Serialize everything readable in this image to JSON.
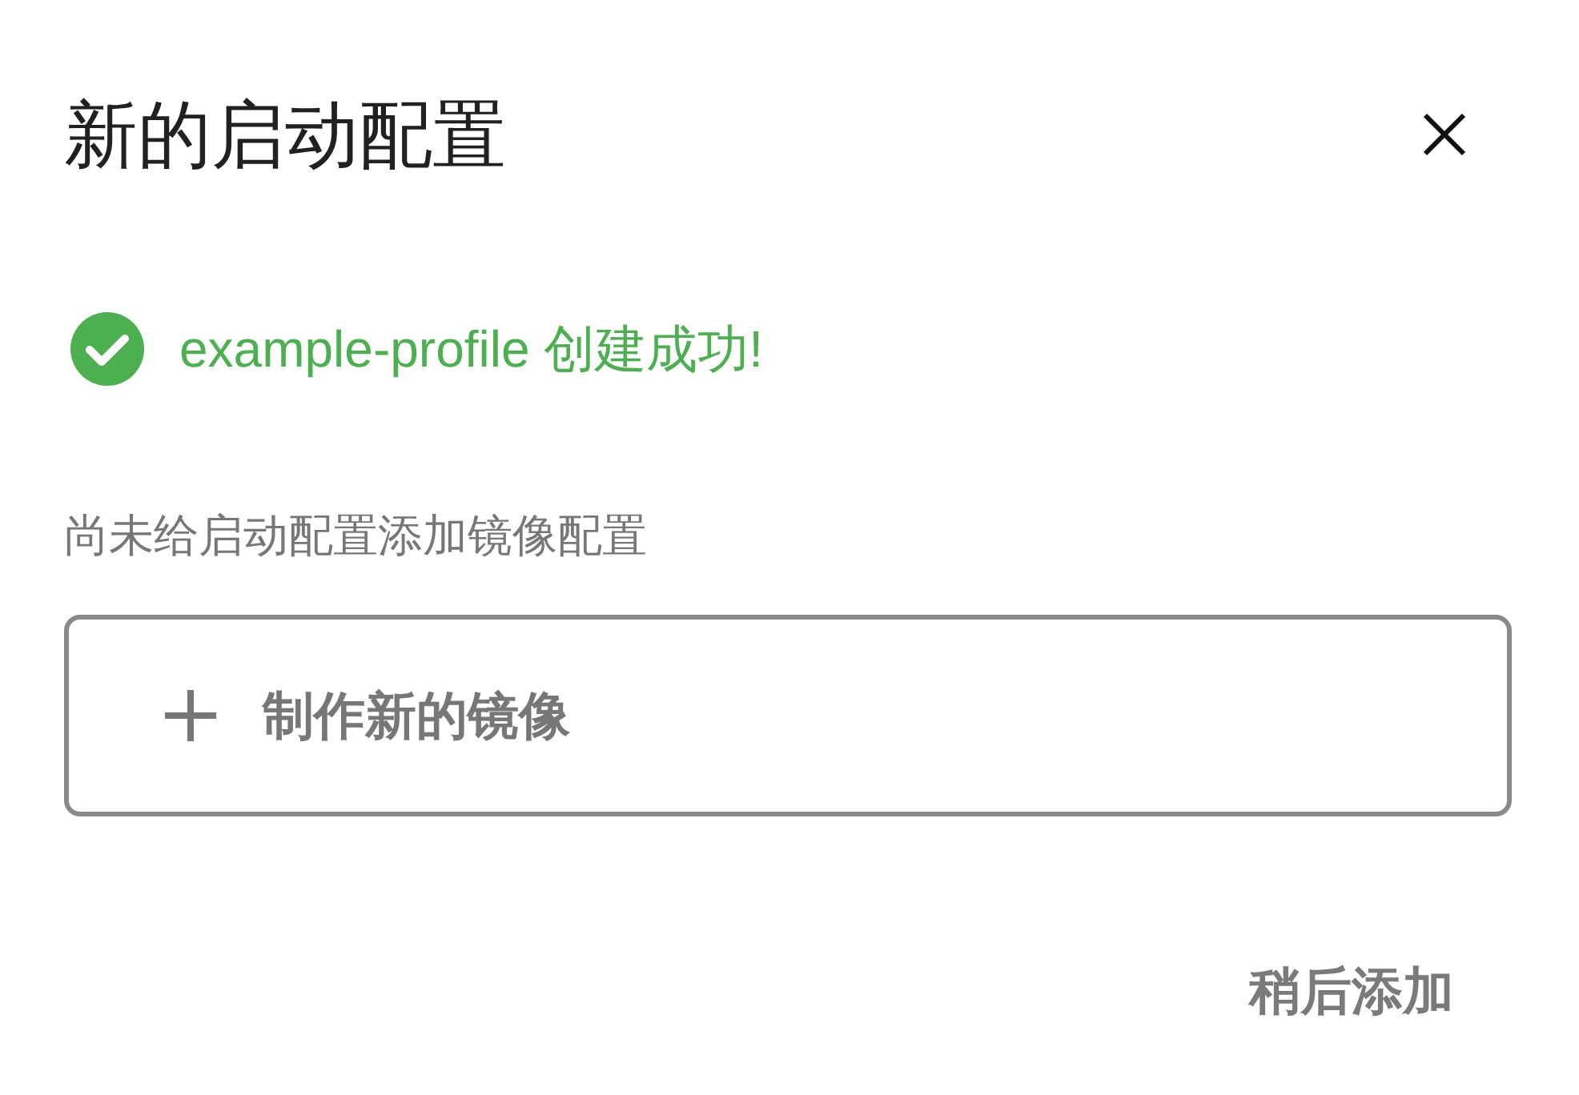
{
  "dialog": {
    "title": "新的启动配置"
  },
  "status": {
    "kind": "success",
    "text": "example-profile 创建成功!"
  },
  "hint": "尚未给启动配置添加镜像配置",
  "action": {
    "label": "制作新的镜像"
  },
  "footer_buttons": [
    "稍后添加"
  ]
}
